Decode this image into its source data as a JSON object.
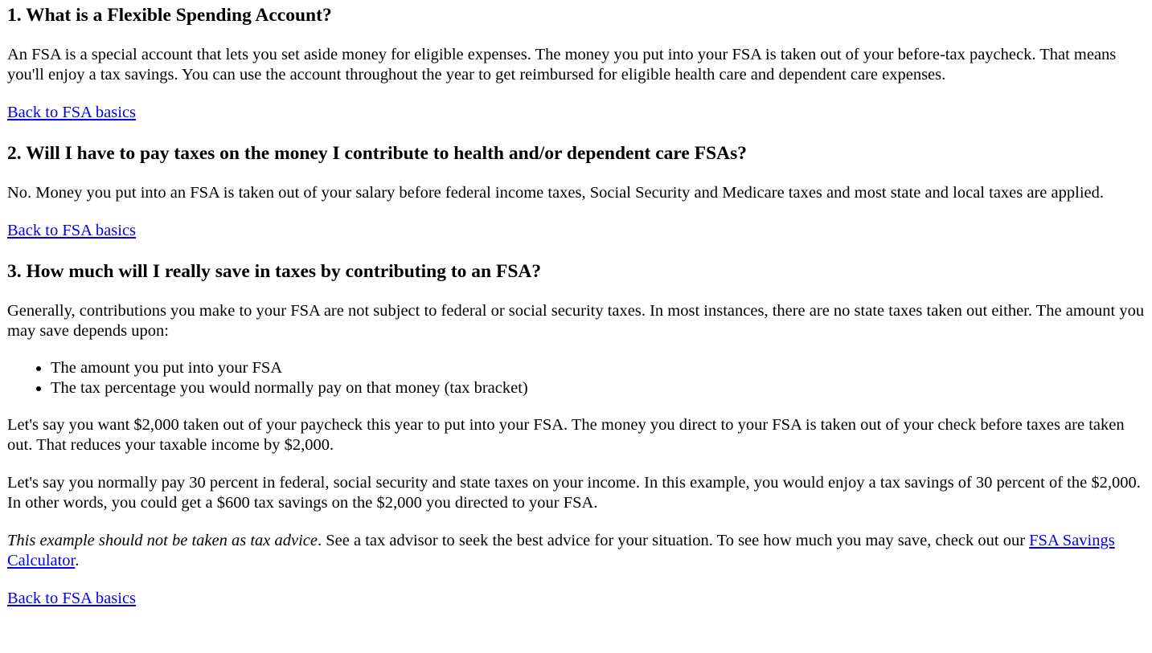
{
  "sections": [
    {
      "title": "1. What is a Flexible Spending Account?",
      "paragraph": "An FSA is a special account that lets you set aside money for eligible expenses. The money you put into your FSA is taken out of your before-tax paycheck. That means you'll enjoy a tax savings. You can use the account throughout the year to get reimbursed for eligible health care and dependent care expenses.",
      "back_link": "Back to FSA basics"
    },
    {
      "title": "2. Will I have to pay taxes on the money I contribute to health and/or dependent care FSAs?",
      "paragraph": "No. Money you put into an FSA is taken out of your salary before federal income taxes, Social Security and Medicare taxes and most state and local taxes are applied.",
      "back_link": "Back to FSA basics"
    },
    {
      "title": "3. How much will I really save in taxes by contributing to an FSA?",
      "paragraph": "Generally, contributions you make to your FSA are not subject to federal or social security taxes. In most instances, there are no state taxes taken out either. The amount you may save depends upon:",
      "list": [
        "The amount you put into your FSA",
        "The tax percentage you would normally pay on that money (tax bracket)"
      ],
      "paragraph_2": "Let's say you want $2,000 taken out of your paycheck this year to put into your FSA. The money you direct to your FSA is taken out of your check before taxes are taken out. That reduces your taxable income by $2,000.",
      "paragraph_3": "Let's say you normally pay 30 percent in federal, social security and state taxes on your income. In this example, you would enjoy a tax savings of 30 percent of the $2,000. In other words, you could get a $600 tax savings on the $2,000 you directed to your FSA.",
      "disclaimer_italic": "This example should not be taken as tax advice",
      "disclaimer_rest": ". See a tax advisor to seek the best advice for your situation. To see how much you may save, check out our ",
      "calculator_link": "FSA Savings Calculator",
      "period": ".",
      "back_link": "Back to FSA basics"
    }
  ]
}
